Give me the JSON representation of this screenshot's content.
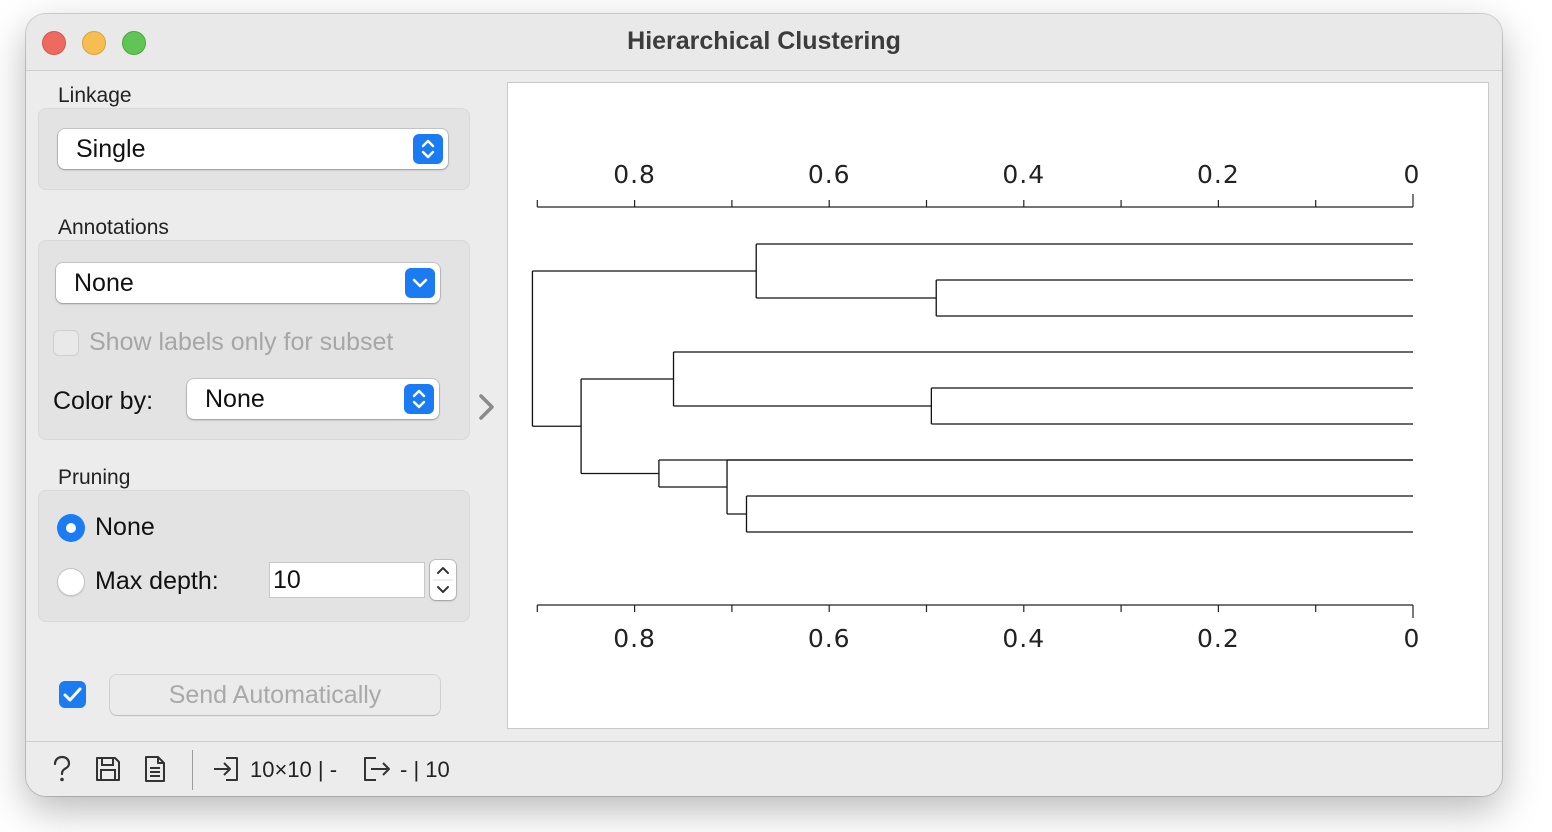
{
  "window": {
    "title": "Hierarchical Clustering"
  },
  "linkage": {
    "label": "Linkage",
    "value": "Single"
  },
  "annotations": {
    "label": "Annotations",
    "value": "None",
    "show_labels_subset": "Show labels only for subset",
    "color_by_label": "Color by:",
    "color_by_value": "None"
  },
  "pruning": {
    "label": "Pruning",
    "option_none": "None",
    "option_max_depth": "Max depth:",
    "max_depth_value": "10",
    "selected": "None"
  },
  "send": {
    "auto_checked": true,
    "button_label": "Send Automatically"
  },
  "statusbar": {
    "input_summary": "10×10 | -",
    "output_summary": "- | 10"
  },
  "colors": {
    "accent": "#1a7bf2",
    "close": "#ee6a5f",
    "minimize": "#f6be50",
    "maximize": "#61c555"
  },
  "chart_data": {
    "type": "dendrogram",
    "axis_ticks": [
      "0.8",
      "0.6",
      "0.4",
      "0.2",
      "0"
    ],
    "axis_tick_values": [
      0.8,
      0.6,
      0.4,
      0.2,
      0
    ],
    "axis_positions": [
      "top",
      "bottom"
    ],
    "xlim": [
      0.9,
      0
    ],
    "leaf_count": 9,
    "merges": [
      {
        "left": "leaf2",
        "right": "leaf3",
        "height": 0.49,
        "id": "c1"
      },
      {
        "left": "leaf1",
        "right": "c1",
        "height": 0.675,
        "id": "c2"
      },
      {
        "left": "leaf5",
        "right": "leaf6",
        "height": 0.495,
        "id": "c3"
      },
      {
        "left": "leaf4",
        "right": "c3",
        "height": 0.76,
        "id": "c4"
      },
      {
        "left": "leaf8",
        "right": "leaf9",
        "height": 0.685,
        "id": "c5"
      },
      {
        "left": "leaf7",
        "right": "c5",
        "height": 0.705,
        "id": "c6"
      },
      {
        "left": "c6",
        "right": "",
        "height": 0.775,
        "id": "c7"
      },
      {
        "left": "c4",
        "right": "c7",
        "height": 0.855,
        "id": "c8"
      },
      {
        "left": "c2",
        "right": "c8",
        "height": 0.905,
        "id": "root"
      }
    ]
  }
}
